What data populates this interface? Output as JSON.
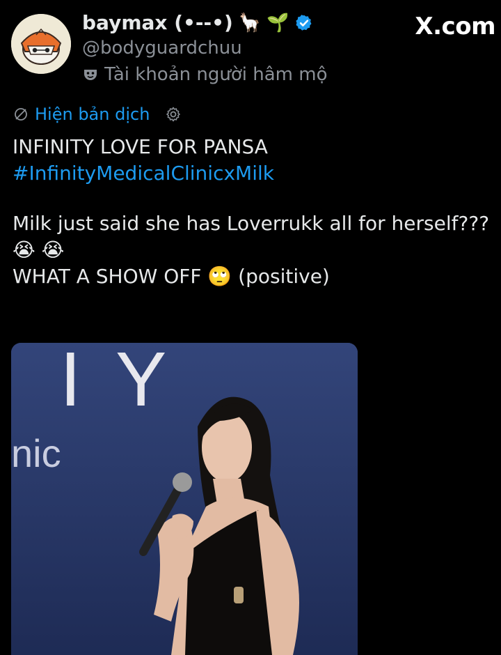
{
  "header": {
    "display_name": "baymax (•--•)",
    "name_emojis": [
      "🦙",
      "🌱"
    ],
    "handle": "@bodyguardchuu",
    "fan_label": "Tài khoản người hâm mộ",
    "brand": "X.com"
  },
  "translate": {
    "label": "Hiện bản dịch"
  },
  "tweet": {
    "line1": "INFINITY LOVE FOR PANSA",
    "hashtag": "#InfinityMedicalClinicxMilk",
    "line3": "Milk just said she has Loverrukk all for herself???",
    "line4": "😭 😭",
    "line5_text": "WHAT A SHOW OFF",
    "line5_emoji": "🙄",
    "line5_suffix": "(positive)"
  },
  "media": {
    "backdrop_letters": [
      "I",
      "Y"
    ],
    "backdrop_word": "nic"
  },
  "colors": {
    "background": "#000000",
    "text": "#e7e9ea",
    "muted": "#8b9097",
    "link": "#1d9bf0",
    "verified": "#1d9bf0",
    "media_bg": "#2b3b6a"
  },
  "icons": {
    "verified": "verified-badge-icon",
    "fan": "mask-icon",
    "translate": "translate-icon",
    "settings": "gear-icon"
  }
}
